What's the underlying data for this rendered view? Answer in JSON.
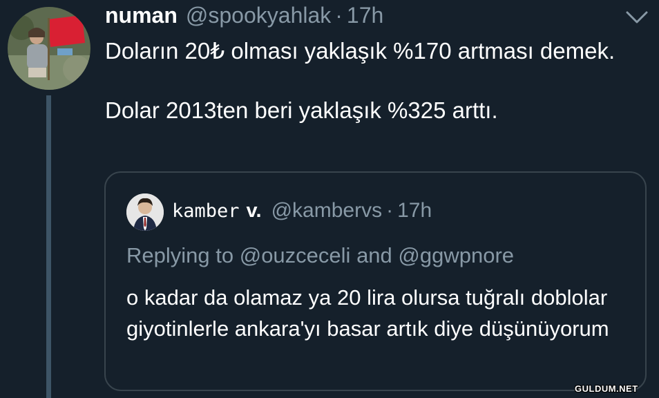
{
  "tweet": {
    "display_name": "numan",
    "handle": "@spookyahlak",
    "separator": "·",
    "time": "17h",
    "avatar_icon": "profile-photo-icon",
    "menu_icon": "chevron-down-icon",
    "lines": [
      "Doların 20₺ olması yaklaşık %170 artması demek.",
      "Dolar 2013ten beri yaklaşık %325 arttı."
    ]
  },
  "quote": {
    "display_name_mono": "kamber",
    "display_name_bold": "v.",
    "handle": "@kambervs",
    "separator": "·",
    "time": "17h",
    "avatar_icon": "profile-photo-icon",
    "replying_prefix": "Replying to",
    "replying_user1": "@ouzceceli",
    "replying_and": "and",
    "replying_user2": "@ggwpnore",
    "text": "o kadar da olamaz ya 20 lira olursa tuğralı doblolar giyotinlerle ankara'yı basar artık diye düşünüyorum"
  },
  "watermark": "GULDUM.NET",
  "colors": {
    "background": "#15202b",
    "primary_text": "#ffffff",
    "secondary_text": "#8899a6",
    "border": "#38444d",
    "thread_line": "#3d5466"
  }
}
